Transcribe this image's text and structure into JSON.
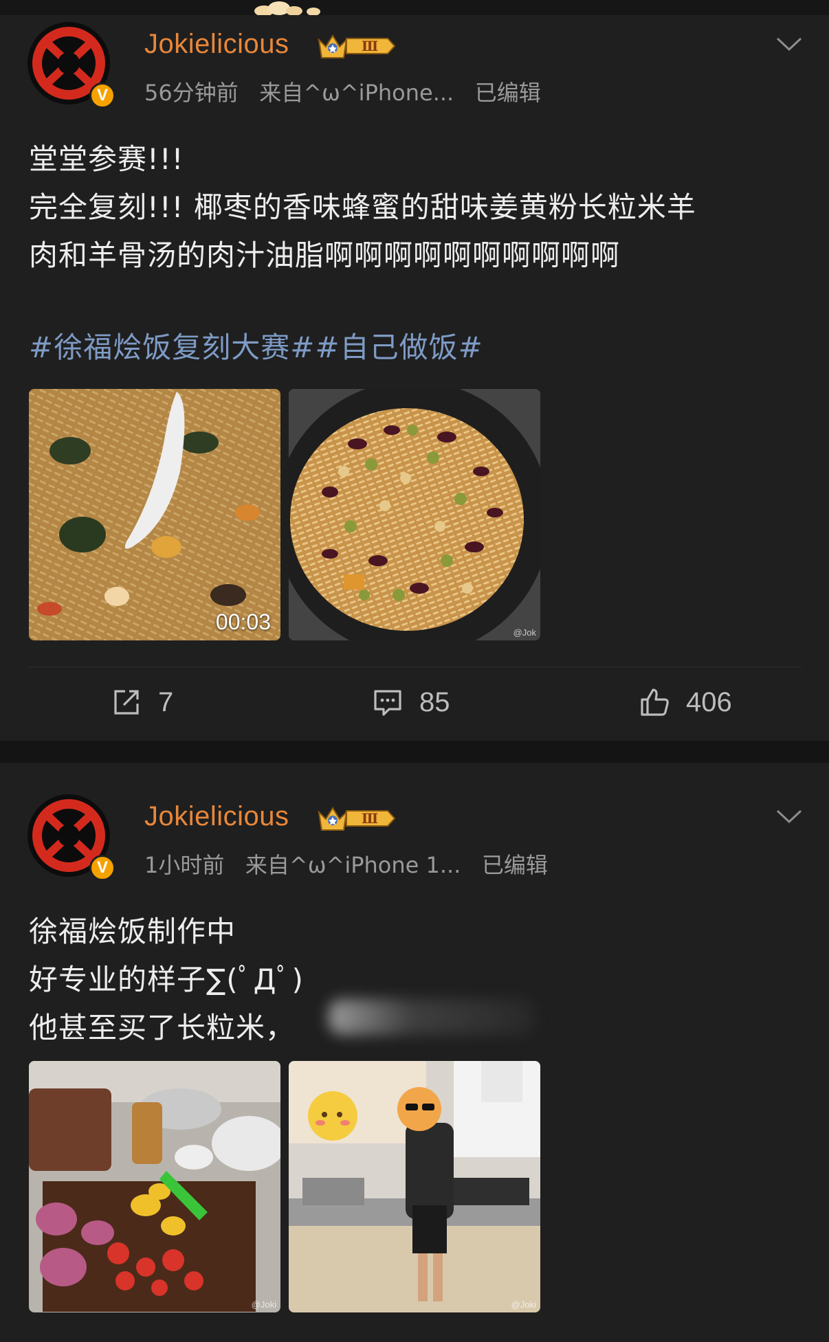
{
  "posts": [
    {
      "username": "Jokielicious",
      "level_badge": "Ⅲ",
      "verified_badge": "V",
      "time": "56分钟前",
      "source": "来自^ω^iPhone...",
      "edited": "已编辑",
      "lines": [
        "堂堂参赛!!!",
        "完全复刻!!!  椰枣的香味蜂蜜的甜味姜黄粉长粒米羊",
        "肉和羊骨汤的肉汁油脂啊啊啊啊啊啊啊啊啊啊"
      ],
      "hashtags": "#徐福烩饭复刻大赛##自己做饭#",
      "video_duration": "00:03",
      "image_watermark": "@Jok",
      "repost_count": "7",
      "comment_count": "85",
      "like_count": "406"
    },
    {
      "username": "Jokielicious",
      "level_badge": "Ⅲ",
      "verified_badge": "V",
      "time": "1小时前",
      "source": "来自^ω^iPhone 1...",
      "edited": "已编辑",
      "lines": [
        "徐福烩饭制作中",
        "好专业的样子∑(ﾟДﾟ)",
        "他甚至买了长粒米，"
      ],
      "image_watermark_1": "@Joki",
      "image_watermark_2": "@Joki"
    }
  ],
  "icons": {
    "repost": "repost-icon",
    "comment": "comment-icon",
    "like": "like-icon",
    "more": "chevron-down-icon"
  },
  "colors": {
    "background": "#1f1f1f",
    "username": "#e8873a",
    "hashtag": "#7e9bc6",
    "meta": "#9a9a9a"
  }
}
